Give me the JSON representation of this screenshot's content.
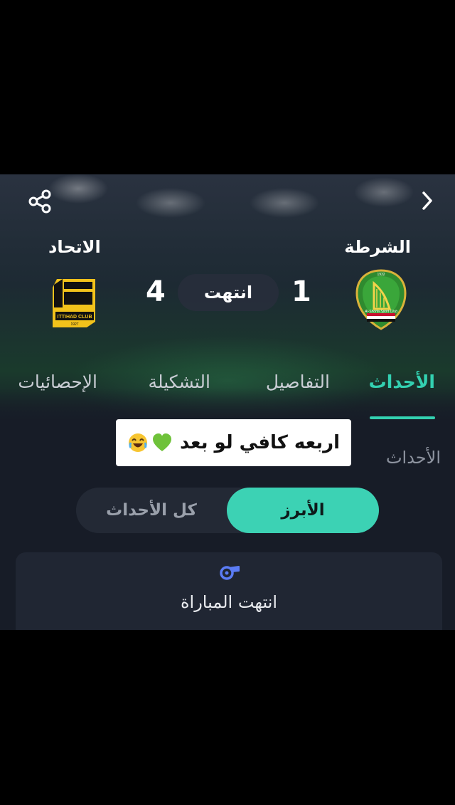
{
  "header": {
    "back_icon": "chevron-right-icon",
    "share_icon": "share-icon"
  },
  "match": {
    "home_team": "الشرطة",
    "away_team": "الاتحاد",
    "home_score": "1",
    "away_score": "4",
    "status": "انتهت",
    "home_logo_text": "Al-Shorta Sport Club",
    "home_logo_year": "1932",
    "away_logo_text": "ITTIHAD CLUB",
    "away_logo_year": "1927"
  },
  "tabs": [
    {
      "label": "الأحداث",
      "active": true
    },
    {
      "label": "التفاصيل",
      "active": false
    },
    {
      "label": "التشكيلة",
      "active": false
    },
    {
      "label": "الإحصائيات",
      "active": false
    }
  ],
  "section_title": "الأحداث",
  "caption": {
    "text": "اربعه كافي لو بعد",
    "emojis": [
      "laughing-face-icon",
      "green-heart-icon"
    ]
  },
  "filter": {
    "selected": "الأبرز",
    "other": "كل الأحداث"
  },
  "event_card": {
    "icon": "whistle-icon",
    "text": "انتهت المباراة"
  },
  "colors": {
    "accent": "#33d1b1",
    "background": "#171c27",
    "card": "#202633",
    "ittihad_yellow": "#f2c21b"
  }
}
